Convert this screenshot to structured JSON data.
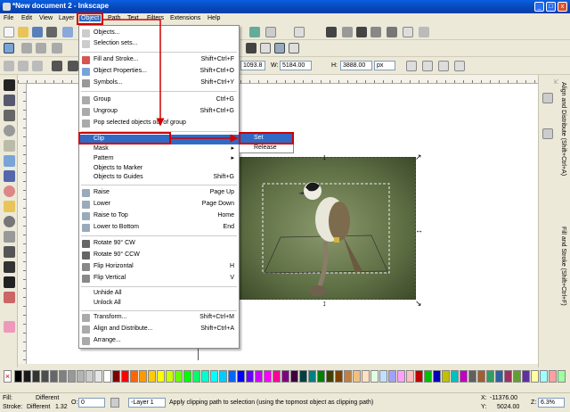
{
  "window": {
    "title": "*New document 2 - Inkscape",
    "min": "_",
    "max": "□",
    "close": "x"
  },
  "menubar": [
    {
      "label": "File"
    },
    {
      "label": "Edit"
    },
    {
      "label": "View"
    },
    {
      "label": "Layer"
    },
    {
      "label": "Object"
    },
    {
      "label": "Path"
    },
    {
      "label": "Text"
    },
    {
      "label": "Filters"
    },
    {
      "label": "Extensions"
    },
    {
      "label": "Help"
    }
  ],
  "toolcontrols": {
    "x_value": "1093.8",
    "w_label": "W:",
    "w_value": "5184.00",
    "h_label": "H:",
    "h_value": "3888.00",
    "unit": "px"
  },
  "object_menu": [
    {
      "label": "Objects...",
      "shortcut": ""
    },
    {
      "label": "Selection sets...",
      "shortcut": ""
    },
    {
      "label": "Fill and Stroke...",
      "shortcut": "Shift+Ctrl+F"
    },
    {
      "label": "Object Properties...",
      "shortcut": "Shift+Ctrl+O"
    },
    {
      "label": "Symbols...",
      "shortcut": "Shift+Ctrl+Y"
    },
    {
      "label": "Group",
      "shortcut": "Ctrl+G"
    },
    {
      "label": "Ungroup",
      "shortcut": "Shift+Ctrl+G"
    },
    {
      "label": "Pop selected objects out of group",
      "shortcut": ""
    },
    {
      "label": "Clip",
      "shortcut": ""
    },
    {
      "label": "Mask",
      "shortcut": ""
    },
    {
      "label": "Pattern",
      "shortcut": ""
    },
    {
      "label": "Objects to Marker",
      "shortcut": ""
    },
    {
      "label": "Objects to Guides",
      "shortcut": "Shift+G"
    },
    {
      "label": "Raise",
      "shortcut": "Page Up"
    },
    {
      "label": "Lower",
      "shortcut": "Page Down"
    },
    {
      "label": "Raise to Top",
      "shortcut": "Home"
    },
    {
      "label": "Lower to Bottom",
      "shortcut": "End"
    },
    {
      "label": "Rotate 90° CW",
      "shortcut": ""
    },
    {
      "label": "Rotate 90° CCW",
      "shortcut": ""
    },
    {
      "label": "Flip Horizontal",
      "shortcut": "H"
    },
    {
      "label": "Flip Vertical",
      "shortcut": "V"
    },
    {
      "label": "Unhide All",
      "shortcut": ""
    },
    {
      "label": "Unlock All",
      "shortcut": ""
    },
    {
      "label": "Transform...",
      "shortcut": "Shift+Ctrl+M"
    },
    {
      "label": "Align and Distribute...",
      "shortcut": "Shift+Ctrl+A"
    },
    {
      "label": "Arrange...",
      "shortcut": ""
    }
  ],
  "clip_submenu": [
    {
      "label": "Set"
    },
    {
      "label": "Release"
    }
  ],
  "right_dock": {
    "align": "Align and Distribute (Shift+Ctrl+A)",
    "fill": "Fill and Stroke (Shift+Ctrl+F)"
  },
  "status": {
    "fill_label": "Fill:",
    "fill_value": "Different",
    "stroke_label": "Stroke:",
    "stroke_value": "Different",
    "stroke_width": "1.32",
    "opacity_label": "O:",
    "opacity_value": "0",
    "layer": "-Layer 1",
    "message": "Apply clipping path to selection (using the topmost object as clipping path)",
    "x_label": "X:",
    "x_value": "-11376.00",
    "y_label": "Y:",
    "y_value": "5024.00",
    "z_label": "Z:",
    "zoom": "6.3%"
  },
  "colors": {
    "highlight": "#316ac5",
    "annotation": "#d00000"
  }
}
